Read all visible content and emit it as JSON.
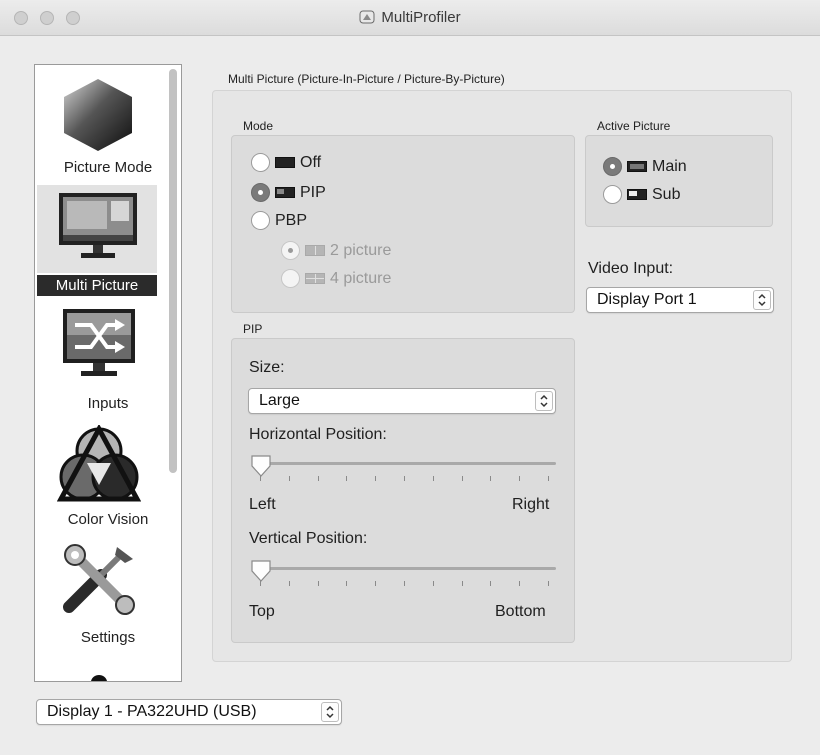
{
  "window": {
    "title": "MultiProfiler"
  },
  "sidebar": {
    "items": [
      {
        "label": "Picture Mode"
      },
      {
        "label": "Multi Picture"
      },
      {
        "label": "Inputs"
      },
      {
        "label": "Color Vision"
      },
      {
        "label": "Settings"
      }
    ]
  },
  "main": {
    "group_title": "Multi Picture (Picture-In-Picture / Picture-By-Picture)",
    "mode": {
      "title": "Mode",
      "options": [
        {
          "label": "Off"
        },
        {
          "label": "PIP"
        },
        {
          "label": "PBP"
        }
      ],
      "selected": "PIP",
      "pbp_sub": [
        {
          "label": "2 picture"
        },
        {
          "label": "4 picture"
        }
      ]
    },
    "active_picture": {
      "title": "Active Picture",
      "options": [
        {
          "label": "Main"
        },
        {
          "label": "Sub"
        }
      ],
      "selected": "Main"
    },
    "video_input": {
      "label": "Video Input:",
      "value": "Display Port 1"
    },
    "pip": {
      "title": "PIP",
      "size_label": "Size:",
      "size_value": "Large",
      "horizontal": {
        "label": "Horizontal Position:",
        "min_label": "Left",
        "max_label": "Right",
        "value": 0
      },
      "vertical": {
        "label": "Vertical Position:",
        "min_label": "Top",
        "max_label": "Bottom",
        "value": 0
      }
    }
  },
  "footer": {
    "display_select": "Display 1 - PA322UHD (USB)"
  }
}
